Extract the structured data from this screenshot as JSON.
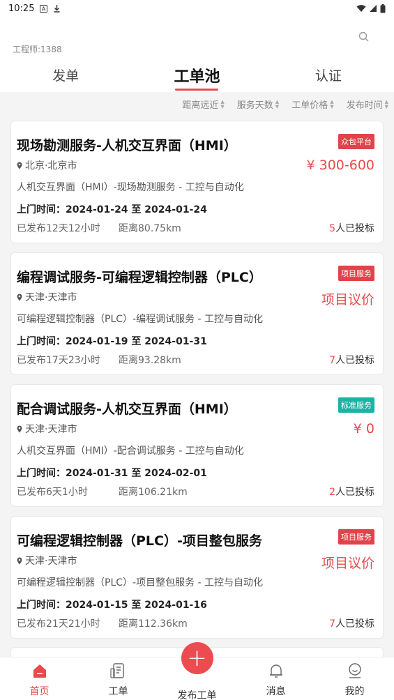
{
  "status_bar": {
    "time": "10:25"
  },
  "header": {
    "engineer": "工程师:1388",
    "tabs": [
      {
        "label": "发单",
        "active": false
      },
      {
        "label": "工单池",
        "active": true
      },
      {
        "label": "认证",
        "active": false
      }
    ]
  },
  "filters": [
    "距离远近",
    "服务天数",
    "工单价格",
    "发布时间"
  ],
  "cards": [
    {
      "title": "现场勘测服务-人机交互界面（HMI）",
      "badge": "众包平台",
      "badge_color": "#e2434a",
      "location": "北京·北京市",
      "price": "¥ 300-600",
      "desc": "人机交互界面（HMI）-现场勘测服务 - 工控与自动化",
      "visit": "上门时间：2024-01-24 至 2024-01-24",
      "published": "已发布12天12小时",
      "distance": "距离80.75km",
      "bid_count": "5",
      "bid_suffix": "人已投标"
    },
    {
      "title": "编程调试服务-可编程逻辑控制器（PLC）",
      "badge": "项目服务",
      "badge_color": "#e2434a",
      "location": "天津·天津市",
      "price": "项目议价",
      "desc": "可编程逻辑控制器（PLC）-编程调试服务 - 工控与自动化",
      "visit": "上门时间：2024-01-19 至 2024-01-31",
      "published": "已发布17天23小时",
      "distance": "距离93.28km",
      "bid_count": "7",
      "bid_suffix": "人已投标"
    },
    {
      "title": "配合调试服务-人机交互界面（HMI）",
      "badge": "标准服务",
      "badge_color": "#1bb3a6",
      "location": "天津·天津市",
      "price": "¥ 0",
      "desc": "人机交互界面（HMI）-配合调试服务 - 工控与自动化",
      "visit": "上门时间：2024-01-31 至 2024-02-01",
      "published": "已发布6天1小时",
      "distance": "距离106.21km",
      "bid_count": "2",
      "bid_suffix": "人已投标"
    },
    {
      "title": "可编程逻辑控制器（PLC）-项目整包服务",
      "badge": "项目服务",
      "badge_color": "#e2434a",
      "location": "天津·天津市",
      "price": "项目议价",
      "desc": "可编程逻辑控制器（PLC）-项目整包服务 - 工控与自动化",
      "visit": "上门时间：2024-01-15 至 2024-01-16",
      "published": "已发布21天21小时",
      "distance": "距离112.36km",
      "bid_count": "7",
      "bid_suffix": "人已投标"
    }
  ],
  "bottom_nav": [
    {
      "label": "首页",
      "icon": "home-icon",
      "active": true
    },
    {
      "label": "工单",
      "icon": "orders-icon",
      "active": false
    },
    {
      "label": "发布工单",
      "icon": "plus-icon",
      "active": false
    },
    {
      "label": "消息",
      "icon": "bell-icon",
      "active": false
    },
    {
      "label": "我的",
      "icon": "profile-icon",
      "active": false
    }
  ],
  "colors": {
    "accent": "#e94a4a",
    "teal": "#1bb3a6"
  }
}
